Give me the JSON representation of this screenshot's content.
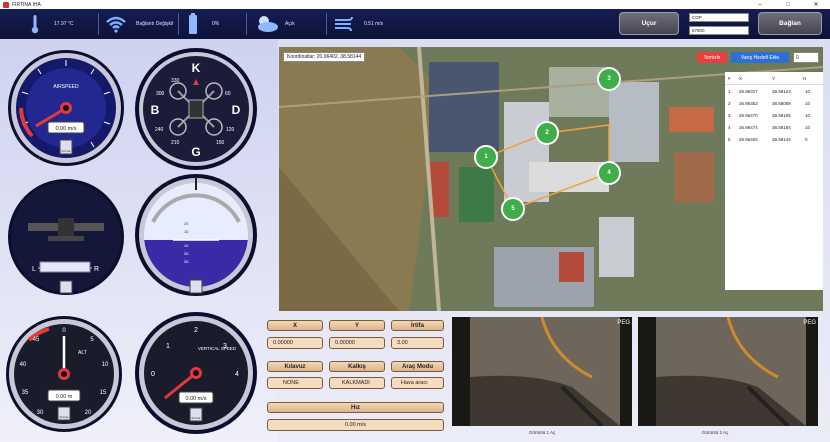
{
  "window": {
    "title": "FIRTINA IHA",
    "minimize": "–",
    "maximize": "□",
    "close": "✕"
  },
  "status": {
    "temperature": "17.97 °C",
    "connection": "Bağlantı Değişkil",
    "battery": "0%",
    "weather": "Açık",
    "wind": "0.51 m/s"
  },
  "controls": {
    "ucur": "Uçur",
    "baglan": "Bağlan",
    "port": "COP",
    "baud": "57600"
  },
  "gauges": {
    "airspeed": {
      "title": "AIRSPEED",
      "value": "0.00 m/s",
      "ticks": [
        "10",
        "20",
        "30",
        "40",
        "50",
        "60",
        "70",
        "80",
        "90",
        "100",
        "0"
      ],
      "brand": "Fırtına"
    },
    "compass": {
      "letters": [
        "K",
        "D",
        "G",
        "B"
      ],
      "ticks": [
        "330",
        "300",
        "60",
        "120",
        "210",
        "150",
        "240"
      ]
    },
    "turn": {
      "left": "L",
      "right": "R"
    },
    "attitude": {
      "marks": [
        "20",
        "10",
        "10",
        "20",
        "20"
      ]
    },
    "altimeter": {
      "title": "ALT",
      "value": "0.00 m",
      "ticks": [
        "0",
        "5",
        "10",
        "15",
        "20",
        "25",
        "30",
        "35",
        "40",
        "45"
      ],
      "brand": "Fırtına"
    },
    "vspeed": {
      "title": "VERTICAL SPEED",
      "value": "0.00 m/s",
      "ticks": [
        "1",
        "2",
        "3",
        "4",
        "0"
      ],
      "brand": "Fırtına"
    }
  },
  "map": {
    "coords": "Koordinatlar: 20.96402, 38.58144",
    "temizle": "Temizle",
    "varis": "Varış Hedefi Ekle",
    "input_val": "0",
    "table": {
      "headers": [
        "#",
        "X",
        "Y",
        "H"
      ],
      "rows": [
        [
          "1",
          "26.96317",
          "38.58123",
          "10"
        ],
        [
          "2",
          "26.96352",
          "38.58089",
          "10"
        ],
        [
          "3",
          "26.96470",
          "38.58105",
          "10"
        ],
        [
          "4",
          "26.96474",
          "38.58184",
          "10"
        ],
        [
          "5",
          "26.96402",
          "38.58144",
          "0"
        ]
      ]
    },
    "markers": [
      "1",
      "2",
      "3",
      "4",
      "5"
    ]
  },
  "panel": {
    "x_label": "X",
    "x_value": "0.00000",
    "y_label": "Y",
    "y_value": "0.00000",
    "irtifa_label": "İrtifa",
    "irtifa_value": "3.00",
    "kilavuz_label": "Kılavuz",
    "kilavuz_value": "NONE",
    "kalkis_label": "Kalkış",
    "kalkis_value": "KALKMADI",
    "arac_label": "Araç Modu",
    "arac_value": "Hava aracı",
    "hiz_label": "Hız",
    "hiz_value": "0.00 m/s"
  },
  "cameras": {
    "cam1_label": "Görüntü 1 Aç",
    "cam2_label": "Görüntü 2 Aç",
    "tag": "PEG"
  },
  "colors": {
    "navy": "#161d52",
    "accent": "#e23a3a",
    "panel": "#f5dcc0"
  }
}
